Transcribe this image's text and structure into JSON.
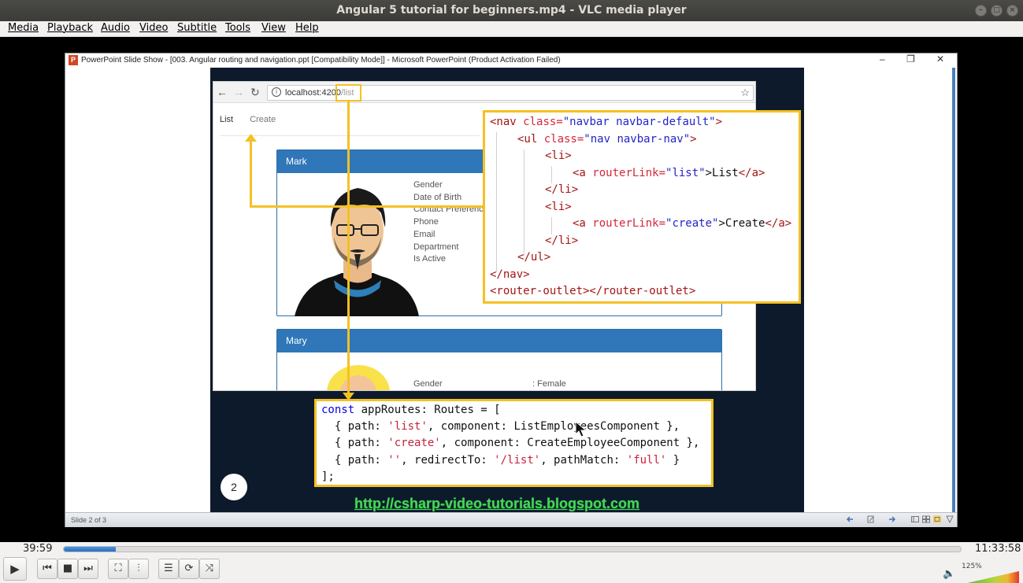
{
  "window": {
    "title": "Angular 5 tutorial for beginners.mp4 - VLC media player"
  },
  "menubar": {
    "items": [
      "Media",
      "Playback",
      "Audio",
      "Video",
      "Subtitle",
      "Tools",
      "View",
      "Help"
    ]
  },
  "ppt": {
    "title": "PowerPoint Slide Show - [003. Angular routing and navigation.ppt [Compatibility Mode]] - Microsoft PowerPoint (Product Activation Failed)",
    "status_slide": "Slide 2 of 3"
  },
  "browser": {
    "url_host": "localhost:4200",
    "url_path": "/list",
    "nav_list": "List",
    "nav_create": "Create",
    "card1": {
      "name": "Mark",
      "fields": [
        "Gender",
        "Date of Birth",
        "Contact Preference",
        "Phone",
        "Email",
        "Department",
        "Is Active"
      ]
    },
    "card2": {
      "name": "Mary",
      "field": "Gender",
      "value": ": Female"
    }
  },
  "nav_code": {
    "line1": {
      "open": "<nav ",
      "attr": "class=",
      "val": "\"navbar navbar-default\"",
      "close": ">"
    },
    "line2": {
      "open": "<ul ",
      "attr": "class=",
      "val": "\"nav navbar-nav\"",
      "close": ">"
    },
    "line3": "<li>",
    "line4": {
      "open": "<a ",
      "attr": "routerLink=",
      "val": "\"list\"",
      "text": ">List",
      "close": "</a>"
    },
    "line5": "</li>",
    "line6": "<li>",
    "line7": {
      "open": "<a ",
      "attr": "routerLink=",
      "val": "\"create\"",
      "text": ">Create",
      "close": "</a>"
    },
    "line8": "</li>",
    "line9": "</ul>",
    "line10": "</nav>",
    "line11": "<router-outlet></router-outlet>"
  },
  "routes_code": {
    "line1": {
      "kw": "const",
      "rest": " appRoutes: Routes = ["
    },
    "line2": {
      "a": "  { path: ",
      "s": "'list'",
      "b": ", component: ListEmployeesComponent },"
    },
    "line3": {
      "a": "  { path: ",
      "s": "'create'",
      "b": ", component: CreateEmployeeComponent },"
    },
    "line4": {
      "a": "  { path: ",
      "s": "''",
      "b": ", redirectTo: ",
      "s2": "'/list'",
      "c": ", pathMatch: ",
      "s3": "'full'",
      "d": " }"
    },
    "line5": "];"
  },
  "slide": {
    "number": "2",
    "link": "http://csharp-video-tutorials.blogspot.com"
  },
  "player": {
    "elapsed": "39:59",
    "total": "11:33:58",
    "progress_fraction": 0.0577,
    "volume_label": "125%",
    "volume_fraction": 1.0
  },
  "colors": {
    "accent_yellow": "#f5c024",
    "card_header": "#2f77b8",
    "slide_bg": "#0c1a2c",
    "link_green": "#4cd456"
  }
}
